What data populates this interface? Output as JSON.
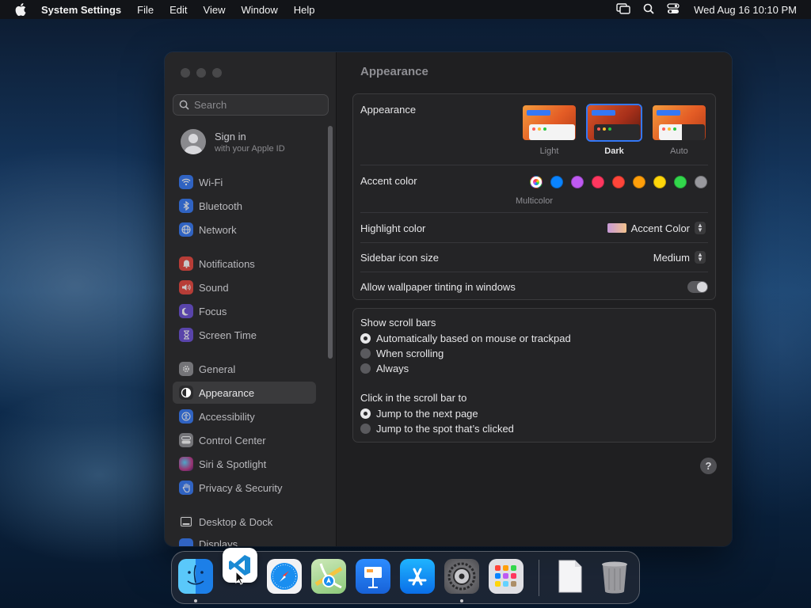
{
  "menubar": {
    "apple_icon": "apple-logo-icon",
    "app_name": "System Settings",
    "menus": [
      "File",
      "Edit",
      "View",
      "Window",
      "Help"
    ],
    "status_icons": [
      "screen-mirroring-icon",
      "search-icon",
      "control-center-icon"
    ],
    "clock": "Wed Aug 16  10:10 PM"
  },
  "sidebar": {
    "search_placeholder": "Search",
    "account": {
      "name": "Sign in",
      "subtitle": "with your Apple ID"
    },
    "items": [
      {
        "label": "Wi-Fi",
        "icon": "wifi-icon",
        "color": "#3478f6"
      },
      {
        "label": "Bluetooth",
        "icon": "bluetooth-icon",
        "color": "#3478f6"
      },
      {
        "label": "Network",
        "icon": "globe-icon",
        "color": "#3478f6"
      },
      {
        "label": "Notifications",
        "icon": "bell-icon",
        "color": "#e8453c"
      },
      {
        "label": "Sound",
        "icon": "speaker-icon",
        "color": "#e8453c"
      },
      {
        "label": "Focus",
        "icon": "moon-icon",
        "color": "#6a4fd6"
      },
      {
        "label": "Screen Time",
        "icon": "hourglass-icon",
        "color": "#6a4fd6"
      },
      {
        "label": "General",
        "icon": "gear-icon",
        "color": "#8e8e93"
      },
      {
        "label": "Appearance",
        "icon": "appearance-icon",
        "color": "#3a3a3c",
        "selected": true
      },
      {
        "label": "Accessibility",
        "icon": "accessibility-icon",
        "color": "#3478f6"
      },
      {
        "label": "Control Center",
        "icon": "control-center-icon",
        "color": "#8e8e93"
      },
      {
        "label": "Siri & Spotlight",
        "icon": "siri-icon",
        "color": "#c0398a"
      },
      {
        "label": "Privacy & Security",
        "icon": "hand-icon",
        "color": "#3478f6"
      },
      {
        "label": "Desktop & Dock",
        "icon": "dock-icon",
        "color": "#2c2c2e"
      },
      {
        "label": "Displays",
        "icon": "display-icon",
        "color": "#3478f6"
      }
    ]
  },
  "main": {
    "title": "Appearance",
    "appearance": {
      "label": "Appearance",
      "options": [
        {
          "label": "Light",
          "selected": false
        },
        {
          "label": "Dark",
          "selected": true
        },
        {
          "label": "Auto",
          "selected": false
        }
      ]
    },
    "accent": {
      "label": "Accent color",
      "caption": "Multicolor",
      "colors": [
        "multicolor",
        "#0a84ff",
        "#bf5af2",
        "#ff375f",
        "#ff453a",
        "#ff9f0a",
        "#ffd60a",
        "#32d74b",
        "#98989d"
      ]
    },
    "highlight": {
      "label": "Highlight color",
      "value": "Accent Color"
    },
    "sidebar_icon_size": {
      "label": "Sidebar icon size",
      "value": "Medium"
    },
    "wallpaper_tinting": {
      "label": "Allow wallpaper tinting in windows",
      "on": false
    },
    "scroll_bars": {
      "label": "Show scroll bars",
      "options": [
        {
          "label": "Automatically based on mouse or trackpad",
          "selected": true
        },
        {
          "label": "When scrolling",
          "selected": false
        },
        {
          "label": "Always",
          "selected": false
        }
      ]
    },
    "scroll_click": {
      "label": "Click in the scroll bar to",
      "options": [
        {
          "label": "Jump to the next page",
          "selected": true
        },
        {
          "label": "Jump to the spot that’s clicked",
          "selected": false
        }
      ]
    },
    "help": "?"
  },
  "dock": {
    "apps": [
      "finder-icon",
      "vscode-icon",
      "safari-icon",
      "maps-icon",
      "keynote-icon",
      "app-store-icon",
      "system-settings-icon",
      "launchpad-icon",
      "document-icon",
      "trash-icon"
    ]
  }
}
